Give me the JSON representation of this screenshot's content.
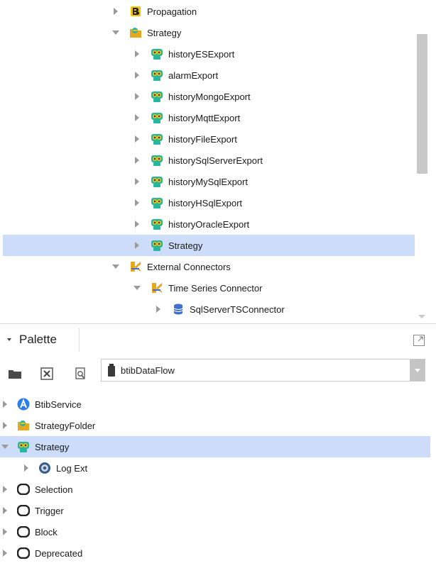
{
  "nav_tree": [
    {
      "label": "Propagation",
      "icon": "propagation-icon",
      "indent": 1,
      "expand": "collapsed",
      "selected": false
    },
    {
      "label": "Strategy",
      "icon": "strategy-folder-icon",
      "indent": 1,
      "expand": "expanded",
      "selected": false
    },
    {
      "label": "historyESExport",
      "icon": "strategy-robot-icon",
      "indent": 2,
      "expand": "collapsed",
      "selected": false
    },
    {
      "label": "alarmExport",
      "icon": "strategy-robot-icon",
      "indent": 2,
      "expand": "collapsed",
      "selected": false
    },
    {
      "label": "historyMongoExport",
      "icon": "strategy-robot-icon",
      "indent": 2,
      "expand": "collapsed",
      "selected": false
    },
    {
      "label": "historyMqttExport",
      "icon": "strategy-robot-icon",
      "indent": 2,
      "expand": "collapsed",
      "selected": false
    },
    {
      "label": "historyFileExport",
      "icon": "strategy-robot-icon",
      "indent": 2,
      "expand": "collapsed",
      "selected": false
    },
    {
      "label": "historySqlServerExport",
      "icon": "strategy-robot-icon",
      "indent": 2,
      "expand": "collapsed",
      "selected": false
    },
    {
      "label": "historyMySqlExport",
      "icon": "strategy-robot-icon",
      "indent": 2,
      "expand": "collapsed",
      "selected": false
    },
    {
      "label": "historyHSqlExport",
      "icon": "strategy-robot-icon",
      "indent": 2,
      "expand": "collapsed",
      "selected": false
    },
    {
      "label": "historyOracleExport",
      "icon": "strategy-robot-icon",
      "indent": 2,
      "expand": "collapsed",
      "selected": false
    },
    {
      "label": "Strategy",
      "icon": "strategy-robot-icon",
      "indent": 2,
      "expand": "collapsed",
      "selected": true
    },
    {
      "label": "External Connectors",
      "icon": "connector-folder-icon",
      "indent": 1,
      "expand": "expanded",
      "selected": false
    },
    {
      "label": "Time Series Connector",
      "icon": "connector-folder-icon",
      "indent": 2,
      "expand": "expanded",
      "selected": false
    },
    {
      "label": "SqlServerTSConnector",
      "icon": "database-icon",
      "indent": 3,
      "expand": "collapsed",
      "selected": false
    },
    {
      "label": "",
      "icon": "database-icon",
      "indent": 3,
      "expand": "collapsed",
      "selected": false
    }
  ],
  "palette": {
    "title": "Palette",
    "module": "btibDataFlow",
    "items": [
      {
        "label": "BtibService",
        "icon": "service-icon",
        "indent": 0,
        "expand": "collapsed",
        "selected": false
      },
      {
        "label": "StrategyFolder",
        "icon": "strategy-folder-icon",
        "indent": 0,
        "expand": "collapsed",
        "selected": false
      },
      {
        "label": "Strategy",
        "icon": "strategy-robot-icon",
        "indent": 0,
        "expand": "expanded",
        "selected": true
      },
      {
        "label": "Log Ext",
        "icon": "gear-icon",
        "indent": 1,
        "expand": "collapsed",
        "selected": false
      },
      {
        "label": "Selection",
        "icon": "component-icon",
        "indent": 0,
        "expand": "collapsed",
        "selected": false
      },
      {
        "label": "Trigger",
        "icon": "component-icon",
        "indent": 0,
        "expand": "collapsed",
        "selected": false
      },
      {
        "label": "Block",
        "icon": "component-icon",
        "indent": 0,
        "expand": "collapsed",
        "selected": false
      },
      {
        "label": "Deprecated",
        "icon": "component-icon",
        "indent": 0,
        "expand": "collapsed",
        "selected": false
      }
    ]
  },
  "colors": {
    "selection": "#cddcf9",
    "service_blue": "#2b7de9",
    "robot_green": "#25b7a0",
    "robot_face": "#f2c200",
    "connector_gold": "#e8a81e",
    "db_blue": "#3f6fcf"
  }
}
